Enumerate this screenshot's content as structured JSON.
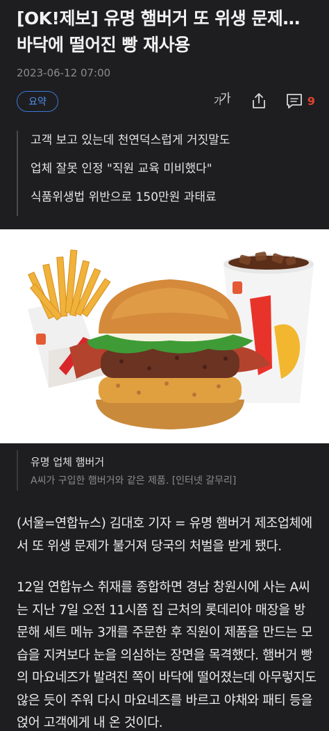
{
  "article": {
    "headline": "[OK!제보] 유명 햄버거 또 위생 문제…바닥에 떨어진 빵 재사용",
    "date": "2023-06-12 07:00"
  },
  "toolbar": {
    "summary_label": "요약",
    "font_size_label": "가",
    "comment_count": "9"
  },
  "summary_bullets": [
    "고객 보고 있는데 천연덕스럽게 거짓말도",
    "업체 잘못 인정 \"직원 교육 미비했다\"",
    "식품위생법 위반으로 150만원 과태료"
  ],
  "photo": {
    "caption_title": "유명 업체 햄버거",
    "caption_desc": "A씨가 구입한 햄버거와 같은 제품. [인터넷 갈무리]"
  },
  "body": {
    "paragraph1": "(서울=연합뉴스) 김대호 기자 = 유명 햄버거 제조업체에서 또 위생 문제가 불거져 당국의 처벌을 받게 됐다.",
    "paragraph2": "12일 연합뉴스 취재를 종합하면 경남 창원시에 사는 A씨는 지난 7일 오전 11시쯤 집 근처의 롯데리아 매장을 방문해 세트 메뉴 3개를 주문한 후 직원이 제품을 만드는 모습을 지켜보다 눈을 의심하는 장면을 목격했다. 햄버거 빵의 마요네즈가 발려진 쪽이 바닥에 떨어졌는데 아무렇지도 않은 듯이 주워 다시 마요네즈를 바르고 야채와 패티 등을 얹어 고객에게 내 온 것이다."
  },
  "colors": {
    "background": "#1e1e21",
    "accent_blue": "#4f8ff0",
    "comment_red": "#e0442c"
  }
}
